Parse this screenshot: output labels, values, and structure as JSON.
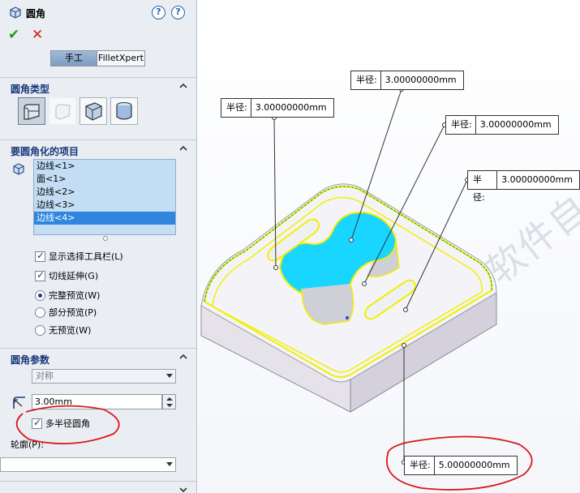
{
  "panel": {
    "title": "圆角",
    "help_icons": [
      "help-tips-icon",
      "help-icon"
    ],
    "ok_icon": "check-icon",
    "cancel_icon": "close-icon",
    "tabs": [
      {
        "label": "手工",
        "active": true
      },
      {
        "label": "FilletXpert",
        "active": false
      }
    ],
    "fillet_type": {
      "title": "圆角类型",
      "options": [
        "constant-size-fillet-icon",
        "variable-size-fillet-icon",
        "face-fillet-icon",
        "full-round-fillet-icon"
      ],
      "selected_index": 0
    },
    "items": {
      "title": "要圆角化的项目",
      "list": [
        "边线<1>",
        "面<1>",
        "边线<2>",
        "边线<3>",
        "边线<4>"
      ],
      "selected_index": 4
    },
    "options": {
      "show_selection_toolbar": {
        "label": "显示选择工具栏(L)",
        "checked": true
      },
      "tangent_propagation": {
        "label": "切线延伸(G)",
        "checked": true
      },
      "full_preview": {
        "label": "完整预览(W)",
        "checked": true
      },
      "partial_preview": {
        "label": "部分预览(P)",
        "checked": false
      },
      "no_preview": {
        "label": "无预览(W)",
        "checked": false
      }
    },
    "params": {
      "title": "圆角参数",
      "method": "对称",
      "radius": "3.00mm",
      "multi_radius": {
        "label": "多半径圆角",
        "checked": true
      },
      "profile_label": "轮廓(P):",
      "profile_value": ""
    }
  },
  "viewport": {
    "callouts": [
      {
        "label": "半径:",
        "value": "3.00000000mm"
      },
      {
        "label": "半径:",
        "value": "3.00000000mm"
      },
      {
        "label": "半径:",
        "value": "3.00000000mm"
      },
      {
        "label": "半径:",
        "value": "3.00000000mm"
      },
      {
        "label": "半径:",
        "value": "5.00000000mm"
      }
    ],
    "watermark": "软件自学网"
  },
  "colors": {
    "panel_bg": "#eaeef3",
    "section_title": "#19357a",
    "list_bg": "#c3ddf4",
    "list_selected": "#2f86dc",
    "edge_highlight": "#ffff00",
    "face_highlight": "#00d5ff",
    "annotation_red": "#d61a1a"
  }
}
